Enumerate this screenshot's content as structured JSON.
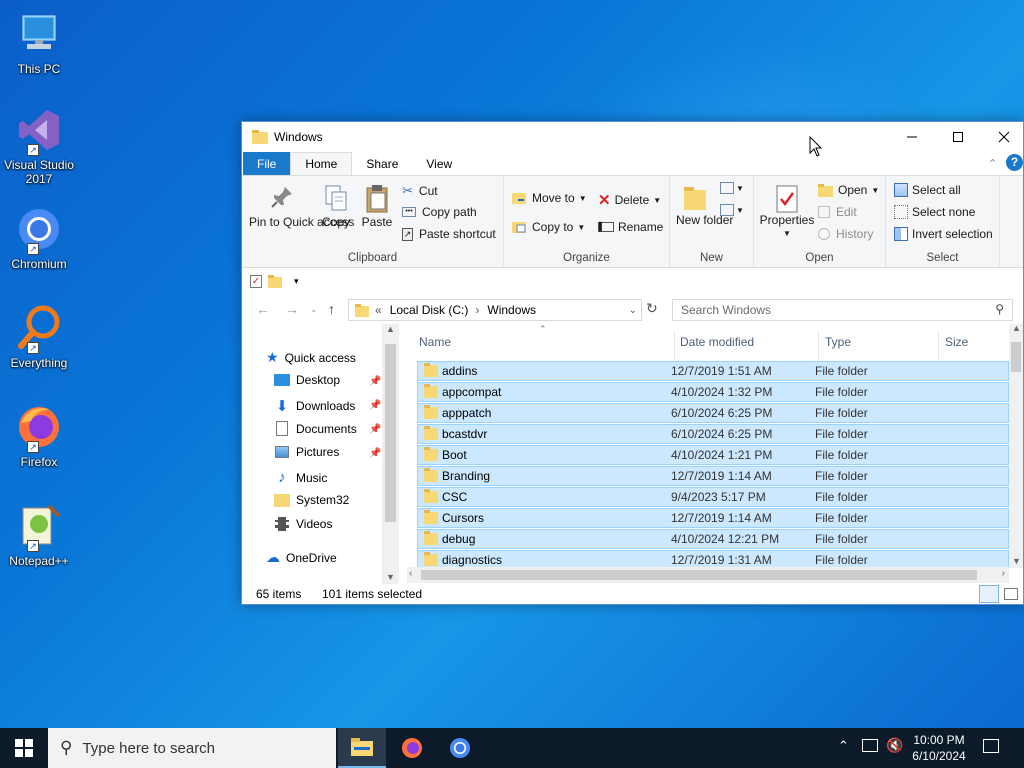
{
  "desktop": {
    "icons": [
      {
        "label": "This PC"
      },
      {
        "label": "Visual Studio 2017"
      },
      {
        "label": "Chromium"
      },
      {
        "label": "Everything"
      },
      {
        "label": "Firefox"
      },
      {
        "label": "Notepad++"
      }
    ]
  },
  "window": {
    "title": "Windows",
    "tabs": {
      "file": "File",
      "home": "Home",
      "share": "Share",
      "view": "View"
    },
    "help": "?",
    "ribbon": {
      "clipboard": {
        "label": "Clipboard",
        "pin": "Pin to Quick access",
        "copy": "Copy",
        "paste": "Paste",
        "cut": "Cut",
        "copy_path": "Copy path",
        "paste_shortcut": "Paste shortcut"
      },
      "organize": {
        "label": "Organize",
        "move_to": "Move to",
        "copy_to": "Copy to",
        "delete": "Delete",
        "rename": "Rename"
      },
      "new": {
        "label": "New",
        "new_folder": "New folder"
      },
      "open": {
        "label": "Open",
        "properties": "Properties",
        "open": "Open",
        "edit": "Edit",
        "history": "History"
      },
      "select": {
        "label": "Select",
        "select_all": "Select all",
        "select_none": "Select none",
        "invert": "Invert selection"
      }
    },
    "address": {
      "overflow": "«",
      "crumb1": "Local Disk (C:)",
      "sep": "›",
      "crumb2": "Windows"
    },
    "search_placeholder": "Search Windows",
    "nav": {
      "quick_access": "Quick access",
      "desktop": "Desktop",
      "downloads": "Downloads",
      "documents": "Documents",
      "pictures": "Pictures",
      "music": "Music",
      "system32": "System32",
      "videos": "Videos",
      "onedrive": "OneDrive"
    },
    "columns": {
      "name": "Name",
      "date": "Date modified",
      "type": "Type",
      "size": "Size"
    },
    "files": [
      {
        "name": "addins",
        "date": "12/7/2019 1:51 AM",
        "type": "File folder"
      },
      {
        "name": "appcompat",
        "date": "4/10/2024 1:32 PM",
        "type": "File folder"
      },
      {
        "name": "apppatch",
        "date": "6/10/2024 6:25 PM",
        "type": "File folder"
      },
      {
        "name": "bcastdvr",
        "date": "6/10/2024 6:25 PM",
        "type": "File folder"
      },
      {
        "name": "Boot",
        "date": "4/10/2024 1:21 PM",
        "type": "File folder"
      },
      {
        "name": "Branding",
        "date": "12/7/2019 1:14 AM",
        "type": "File folder"
      },
      {
        "name": "CSC",
        "date": "9/4/2023 5:17 PM",
        "type": "File folder"
      },
      {
        "name": "Cursors",
        "date": "12/7/2019 1:14 AM",
        "type": "File folder"
      },
      {
        "name": "debug",
        "date": "4/10/2024 12:21 PM",
        "type": "File folder"
      },
      {
        "name": "diagnostics",
        "date": "12/7/2019 1:31 AM",
        "type": "File folder"
      }
    ],
    "status": {
      "items": "65 items",
      "selected": "101 items selected"
    }
  },
  "taskbar": {
    "search_placeholder": "Type here to search",
    "time": "10:00 PM",
    "date": "6/10/2024"
  }
}
